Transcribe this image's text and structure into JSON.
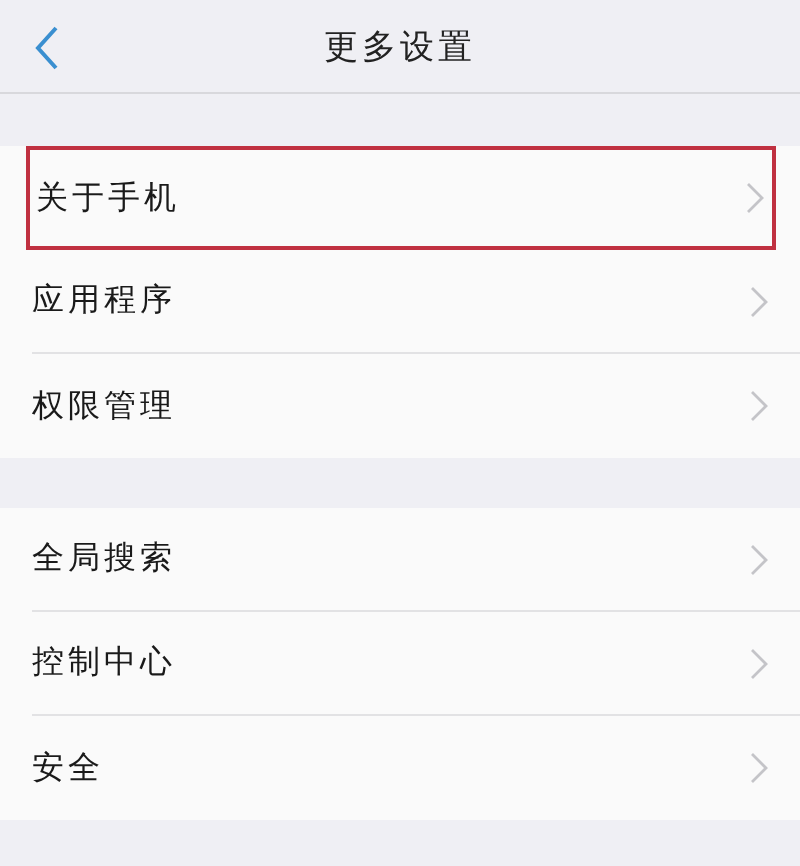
{
  "header": {
    "title": "更多设置"
  },
  "groups": [
    {
      "items": [
        {
          "label": "关于手机",
          "highlighted": true
        },
        {
          "label": "应用程序",
          "highlighted": false
        },
        {
          "label": "权限管理",
          "highlighted": false
        }
      ]
    },
    {
      "items": [
        {
          "label": "全局搜索",
          "highlighted": false
        },
        {
          "label": "控制中心",
          "highlighted": false
        },
        {
          "label": "安全",
          "highlighted": false
        }
      ]
    }
  ]
}
